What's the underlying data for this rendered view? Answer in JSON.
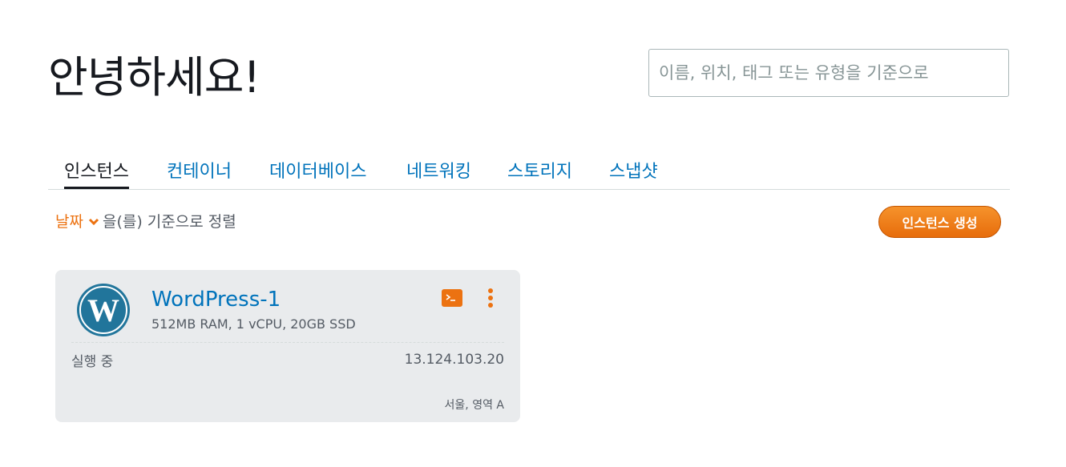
{
  "header": {
    "greeting": "안녕하세요!",
    "search_placeholder": "이름, 위치, 태그 또는 유형을 기준으로"
  },
  "tabs": [
    {
      "label": "인스턴스",
      "active": true
    },
    {
      "label": "컨테이너",
      "active": false
    },
    {
      "label": "데이터베이스",
      "active": false
    },
    {
      "label": "네트워킹",
      "active": false
    },
    {
      "label": "스토리지",
      "active": false
    },
    {
      "label": "스냅샷",
      "active": false
    }
  ],
  "sort": {
    "field": "날짜",
    "suffix": "을(를) 기준으로 정렬"
  },
  "actions": {
    "create_instance_label": "인스턴스 생성"
  },
  "instances": [
    {
      "name": "WordPress-1",
      "spec": "512MB RAM, 1 vCPU, 20GB SSD",
      "state": "실행 중",
      "ip": "13.124.103.20",
      "region": "서울, 영역 A",
      "icons": [
        "wordpress-logo",
        "terminal-icon",
        "more-vertical-icon"
      ]
    }
  ],
  "colors": {
    "accent_orange": "#ec7211",
    "link_blue": "#0073bb",
    "wordpress_blue": "#21759b",
    "card_bg": "#e9ebed"
  }
}
